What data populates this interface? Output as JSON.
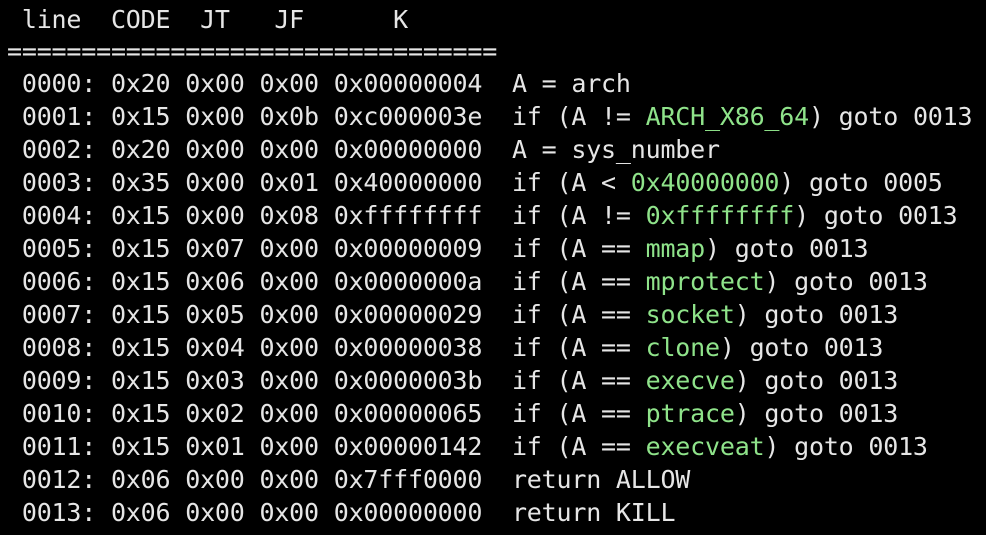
{
  "colors": {
    "background": "#000000",
    "text": "#e6e6e6",
    "highlight": "#8fe38a"
  },
  "header": " line  CODE  JT   JF      K",
  "separator": "=================================",
  "rows": [
    {
      "prefix": " 0000: 0x20 0x00 0x00 0x00000004  A = arch",
      "highlight": "",
      "suffix": ""
    },
    {
      "prefix": " 0001: 0x15 0x00 0x0b 0xc000003e  if (A != ",
      "highlight": "ARCH_X86_64",
      "suffix": ") goto 0013"
    },
    {
      "prefix": " 0002: 0x20 0x00 0x00 0x00000000  A = sys_number",
      "highlight": "",
      "suffix": ""
    },
    {
      "prefix": " 0003: 0x35 0x00 0x01 0x40000000  if (A < ",
      "highlight": "0x40000000",
      "suffix": ") goto 0005"
    },
    {
      "prefix": " 0004: 0x15 0x00 0x08 0xffffffff  if (A != ",
      "highlight": "0xffffffff",
      "suffix": ") goto 0013"
    },
    {
      "prefix": " 0005: 0x15 0x07 0x00 0x00000009  if (A == ",
      "highlight": "mmap",
      "suffix": ") goto 0013"
    },
    {
      "prefix": " 0006: 0x15 0x06 0x00 0x0000000a  if (A == ",
      "highlight": "mprotect",
      "suffix": ") goto 0013"
    },
    {
      "prefix": " 0007: 0x15 0x05 0x00 0x00000029  if (A == ",
      "highlight": "socket",
      "suffix": ") goto 0013"
    },
    {
      "prefix": " 0008: 0x15 0x04 0x00 0x00000038  if (A == ",
      "highlight": "clone",
      "suffix": ") goto 0013"
    },
    {
      "prefix": " 0009: 0x15 0x03 0x00 0x0000003b  if (A == ",
      "highlight": "execve",
      "suffix": ") goto 0013"
    },
    {
      "prefix": " 0010: 0x15 0x02 0x00 0x00000065  if (A == ",
      "highlight": "ptrace",
      "suffix": ") goto 0013"
    },
    {
      "prefix": " 0011: 0x15 0x01 0x00 0x00000142  if (A == ",
      "highlight": "execveat",
      "suffix": ") goto 0013"
    },
    {
      "prefix": " 0012: 0x06 0x00 0x00 0x7fff0000  return ALLOW",
      "highlight": "",
      "suffix": ""
    },
    {
      "prefix": " 0013: 0x06 0x00 0x00 0x00000000  return KILL",
      "highlight": "",
      "suffix": ""
    }
  ]
}
